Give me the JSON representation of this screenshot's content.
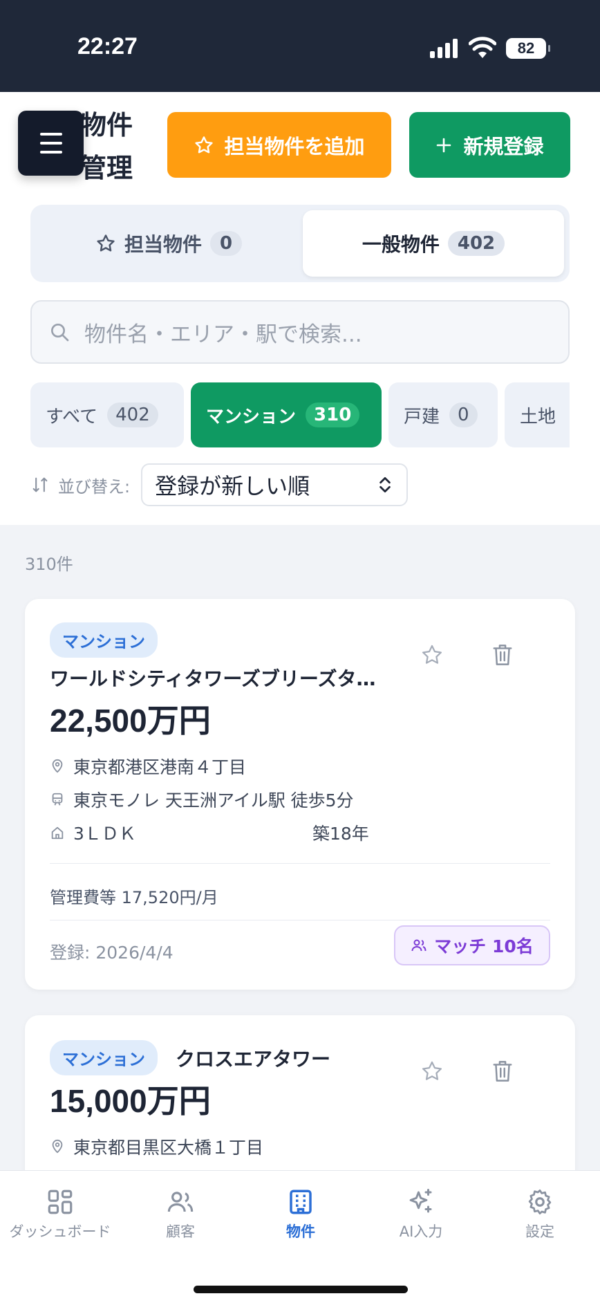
{
  "status_bar": {
    "time": "22:27",
    "battery": "82"
  },
  "header": {
    "title": "物件管理",
    "add_assigned_label": "担当物件を追加",
    "new_register_label": "新規登録"
  },
  "segments": {
    "assigned": {
      "label": "担当物件",
      "count": "0"
    },
    "general": {
      "label": "一般物件",
      "count": "402"
    }
  },
  "search": {
    "placeholder": "物件名・エリア・駅で検索..."
  },
  "filters": [
    {
      "label": "すべて",
      "count": "402"
    },
    {
      "label": "マンション",
      "count": "310"
    },
    {
      "label": "戸建",
      "count": "0"
    },
    {
      "label": "土地",
      "count": ""
    }
  ],
  "sort": {
    "label": "並び替え:",
    "value": "登録が新しい順"
  },
  "result_count": "310件",
  "properties": [
    {
      "type": "マンション",
      "name": "ワールドシティタワーズブリーズタ…",
      "price": "22,500万円",
      "address": "東京都港区港南４丁目",
      "station": "東京モノレ 天王洲アイル駅  徒歩5分",
      "layout": "3ＬＤＫ",
      "age": "築18年",
      "fee": "管理費等 17,520円/月",
      "registered": "登録: 2026/4/4",
      "match": "マッチ 10名"
    },
    {
      "type": "マンション",
      "name": "クロスエアタワー",
      "price": "15,000万円",
      "address": "東京都目黒区大橋１丁目"
    }
  ],
  "nav": {
    "dashboard": "ダッシュボード",
    "customers": "顧客",
    "properties": "物件",
    "ai_input": "AI入力",
    "settings": "設定"
  }
}
